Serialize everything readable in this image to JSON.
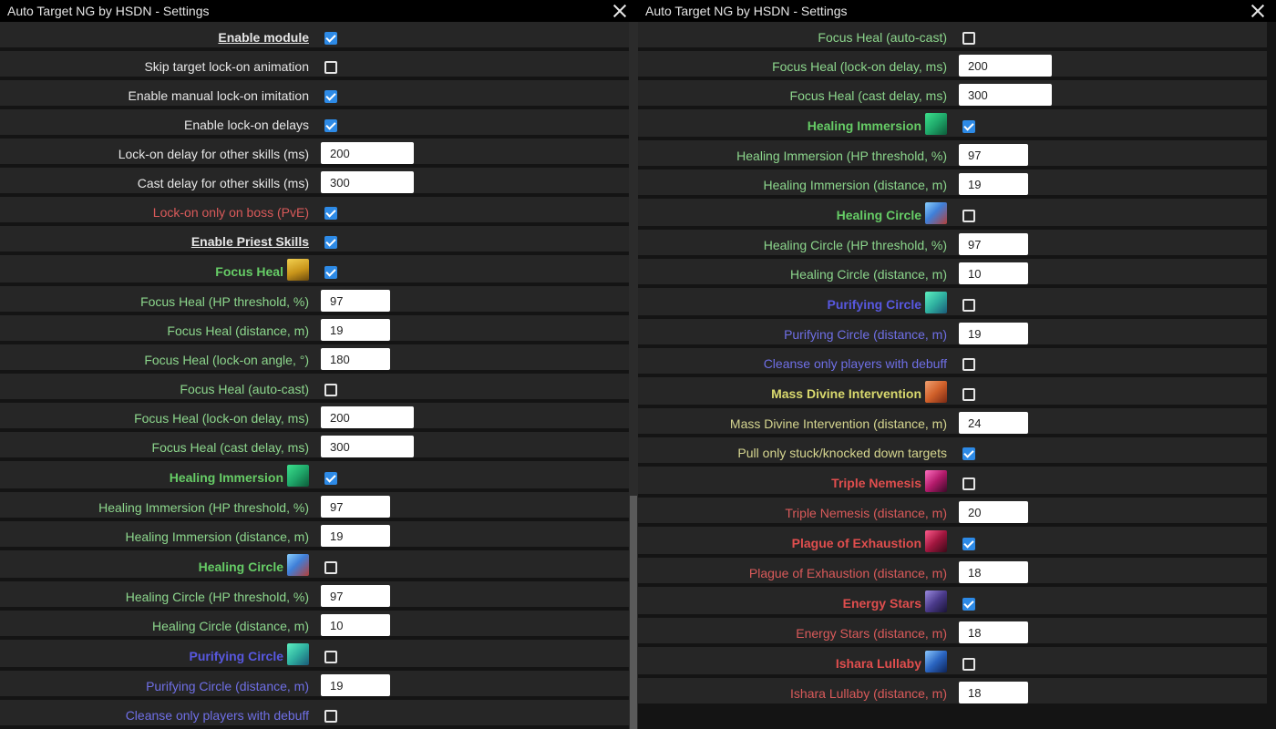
{
  "window_title": "Auto Target NG by HSDN - Settings",
  "colors": {
    "checkbox_checked": "#2d8ae6",
    "general_text": "#e6e6e6",
    "focus_heal_text": "#8cd68c",
    "purify_text": "#6f6fe6",
    "mass_divine_text": "#d6d690",
    "offensive_text": "#d95a5a"
  },
  "left_panel": {
    "rows": [
      {
        "type": "check",
        "label": "Enable module",
        "checked": true
      },
      {
        "type": "check",
        "label": "Skip target lock-on animation",
        "checked": false
      },
      {
        "type": "check",
        "label": "Enable manual lock-on imitation",
        "checked": true
      },
      {
        "type": "check",
        "label": "Enable lock-on delays",
        "checked": true
      },
      {
        "type": "input",
        "label": "Lock-on delay for other skills (ms)",
        "value": "200"
      },
      {
        "type": "input",
        "label": "Cast delay for other skills (ms)",
        "value": "300"
      },
      {
        "type": "check",
        "label": "Lock-on only on boss (PvE)",
        "checked": true
      },
      {
        "type": "check",
        "label": "Enable Priest Skills",
        "checked": true
      },
      {
        "type": "skill",
        "label": "Focus Heal",
        "icon": "focus-heal-icon",
        "checked": true
      },
      {
        "type": "input",
        "label": "Focus Heal (HP threshold, %)",
        "value": "97"
      },
      {
        "type": "input",
        "label": "Focus Heal (distance, m)",
        "value": "19"
      },
      {
        "type": "input",
        "label": "Focus Heal (lock-on angle, °)",
        "value": "180"
      },
      {
        "type": "check",
        "label": "Focus Heal (auto-cast)",
        "checked": false
      },
      {
        "type": "input",
        "label": "Focus Heal (lock-on delay, ms)",
        "value": "200"
      },
      {
        "type": "input",
        "label": "Focus Heal (cast delay, ms)",
        "value": "300"
      },
      {
        "type": "skill",
        "label": "Healing Immersion",
        "icon": "healing-immersion-icon",
        "checked": true
      },
      {
        "type": "input",
        "label": "Healing Immersion (HP threshold, %)",
        "value": "97"
      },
      {
        "type": "input",
        "label": "Healing Immersion (distance, m)",
        "value": "19"
      },
      {
        "type": "skill",
        "label": "Healing Circle",
        "icon": "healing-circle-icon",
        "checked": false
      },
      {
        "type": "input",
        "label": "Healing Circle (HP threshold, %)",
        "value": "97"
      },
      {
        "type": "input",
        "label": "Healing Circle (distance, m)",
        "value": "10"
      },
      {
        "type": "skill",
        "label": "Purifying Circle",
        "icon": "purifying-circle-icon",
        "checked": false
      },
      {
        "type": "input",
        "label": "Purifying Circle (distance, m)",
        "value": "19"
      },
      {
        "type": "check",
        "label": "Cleanse only players with debuff",
        "checked": false
      }
    ]
  },
  "right_panel": {
    "rows": [
      {
        "type": "input",
        "label": "",
        "value": ""
      },
      {
        "type": "check",
        "label": "Focus Heal (auto-cast)",
        "checked": false
      },
      {
        "type": "input",
        "label": "Focus Heal (lock-on delay, ms)",
        "value": "200"
      },
      {
        "type": "input",
        "label": "Focus Heal (cast delay, ms)",
        "value": "300"
      },
      {
        "type": "skill",
        "label": "Healing Immersion",
        "icon": "healing-immersion-icon",
        "checked": true
      },
      {
        "type": "input",
        "label": "Healing Immersion (HP threshold, %)",
        "value": "97"
      },
      {
        "type": "input",
        "label": "Healing Immersion (distance, m)",
        "value": "19"
      },
      {
        "type": "skill",
        "label": "Healing Circle",
        "icon": "healing-circle-icon",
        "checked": false
      },
      {
        "type": "input",
        "label": "Healing Circle (HP threshold, %)",
        "value": "97"
      },
      {
        "type": "input",
        "label": "Healing Circle (distance, m)",
        "value": "10"
      },
      {
        "type": "skill",
        "label": "Purifying Circle",
        "icon": "purifying-circle-icon",
        "checked": false
      },
      {
        "type": "input",
        "label": "Purifying Circle (distance, m)",
        "value": "19"
      },
      {
        "type": "check",
        "label": "Cleanse only players with debuff",
        "checked": false
      },
      {
        "type": "skill",
        "label": "Mass Divine Intervention",
        "icon": "mass-divine-intervention-icon",
        "checked": false
      },
      {
        "type": "input",
        "label": "Mass Divine Intervention (distance, m)",
        "value": "24"
      },
      {
        "type": "check",
        "label": "Pull only stuck/knocked down targets",
        "checked": true
      },
      {
        "type": "skill",
        "label": "Triple Nemesis",
        "icon": "triple-nemesis-icon",
        "checked": false
      },
      {
        "type": "input",
        "label": "Triple Nemesis (distance, m)",
        "value": "20"
      },
      {
        "type": "skill",
        "label": "Plague of Exhaustion",
        "icon": "plague-of-exhaustion-icon",
        "checked": true
      },
      {
        "type": "input",
        "label": "Plague of Exhaustion (distance, m)",
        "value": "18"
      },
      {
        "type": "skill",
        "label": "Energy Stars",
        "icon": "energy-stars-icon",
        "checked": true
      },
      {
        "type": "input",
        "label": "Energy Stars (distance, m)",
        "value": "18"
      },
      {
        "type": "skill",
        "label": "Ishara Lullaby",
        "icon": "ishara-lullaby-icon",
        "checked": false
      },
      {
        "type": "input",
        "label": "Ishara Lullaby (distance, m)",
        "value": "18"
      }
    ]
  }
}
